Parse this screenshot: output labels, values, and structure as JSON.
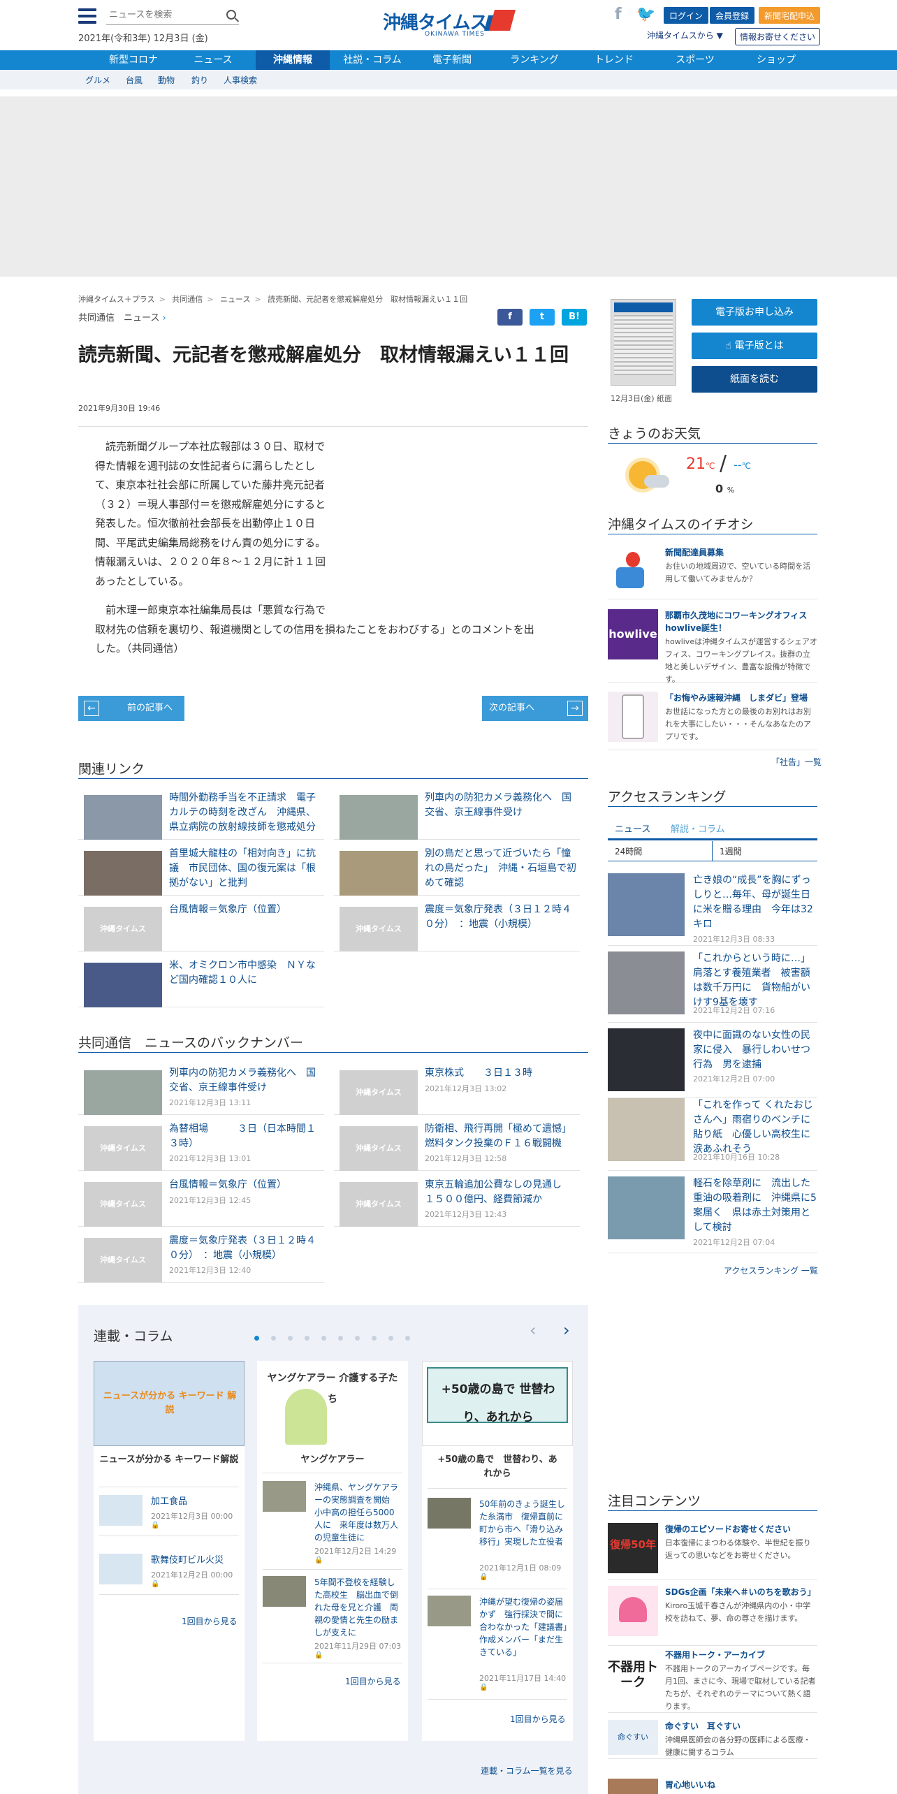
{
  "header": {
    "search_placeholder": "ニュースを検索",
    "date": "2021年(令和3年) 12月3日 (金)",
    "logo_main": "沖縄タイムス",
    "logo_sub": "OKINAWA TIMES",
    "logo_plus": "プラス",
    "login": "ログイン",
    "register": "会員登録",
    "delivery": "新聞宅配申込",
    "region": "沖縄タイムスから ▼",
    "info": "情報お寄せください",
    "colors": {
      "brand": "#0e5ba8",
      "nav": "#1386cf",
      "delivery": "#f39a2d"
    }
  },
  "nav": {
    "items": [
      "新型コロナ",
      "ニュース",
      "沖縄情報",
      "社説・コラム",
      "電子新聞",
      "ランキング",
      "トレンド",
      "スポーツ",
      "ショップ"
    ],
    "active": "沖縄情報",
    "sub": [
      "グルメ",
      "台風",
      "動物",
      "釣り",
      "人事検索"
    ]
  },
  "breadcrumb": [
    "沖縄タイムス＋プラス",
    "共同通信",
    "ニュース",
    "読売新聞、元記者を懲戒解雇処分　取材情報漏えい１１回"
  ],
  "article": {
    "category": "共同通信　ニュース",
    "share": [
      "f",
      "t",
      "B!"
    ],
    "title": "読売新聞、元記者を懲戒解雇処分　取材情報漏えい１１回",
    "date": "2021年9月30日 19:46",
    "p1": [
      "読売新聞グループ本社広報部は３０日、取材で",
      "得た情報を週刊誌の女性記者らに漏らしたとし",
      "て、東京本社社会部に所属していた藤井亮元記者",
      "（３２）＝現人事部付＝を懲戒解雇処分にすると",
      "発表した。恒次徹前社会部長を出勤停止１０日",
      "間、平尾武史編集局総務をけん責の処分にする。",
      "情報漏えいは、２０２０年８～１２月に計１１回",
      "あったとしている。"
    ],
    "p2": [
      "前木理一郎東京本社編集局長は「悪質な行為で",
      "取材先の信頼を裏切り、報道機関としての信用を損ねたことをおわびする」とのコメントを出",
      "した。（共同通信）"
    ],
    "prev": "前の記事へ",
    "next": "次の記事へ"
  },
  "related": {
    "title": "関連リンク",
    "items": [
      "時間外勤務手当を不正請求　電子カルテの時刻を改ざん　沖縄県、県立病院の放射線技師を懲戒処分",
      "列車内の防犯カメラ義務化へ　国交省、京王線事件受け",
      "首里城大龍柱の「相対向き」に抗議　市民団体、国の復元案は「根拠がない」と批判",
      "別の鳥だと思って近づいたら「憧れの鳥だった」　沖縄・石垣島で初めて確認",
      "台風情報＝気象庁（位置）",
      "震度＝気象庁発表（３日１２時４０分）　：地震（小規模）",
      "米、オミクロン市中感染　ＮＹなど国内確認１０人に"
    ],
    "placeholder": "沖縄タイムス"
  },
  "backnumber": {
    "title": "共同通信　ニュースのバックナンバー",
    "items": [
      {
        "t": "列車内の防犯カメラ義務化へ　国交省、京王線事件受け",
        "d": "2021年12月3日 13:11"
      },
      {
        "t": "東京株式　　３日１３時",
        "d": "2021年12月3日 13:02"
      },
      {
        "t": "為替相場　　　３日（日本時間１３時）",
        "d": "2021年12月3日 13:01"
      },
      {
        "t": "防衛相、飛行再開「極めて遺憾」燃料タンク投棄のＦ１６戦闘機",
        "d": "2021年12月3日 12:58"
      },
      {
        "t": "台風情報＝気象庁（位置）",
        "d": "2021年12月3日 12:45"
      },
      {
        "t": "東京五輪追加公費なしの見通し　１５００億円、経費節減か",
        "d": "2021年12月3日 12:43"
      },
      {
        "t": "震度＝気象庁発表（３日１２時４０分）　：地震（小規模）",
        "d": "2021年12月3日 12:40"
      }
    ]
  },
  "series": {
    "title": "連載・コラム",
    "cards": [
      {
        "name": "ニュースが分かる キーワード解説",
        "img_text": "ニュースが分かる キーワード 解説",
        "items": [
          {
            "t": "加工食品",
            "d": "2021年12月3日 00:00"
          },
          {
            "t": "歌舞伎町ビル火災",
            "d": "2021年12月2日 00:00"
          }
        ],
        "more": "1回目から見る"
      },
      {
        "name": "ヤングケアラー",
        "img_text": "ヤングケアラー 介護する子たち",
        "items": [
          {
            "t": "沖縄県、ヤングケアラーの実態調査を開始　小中高の担任ら5000人に　来年度は数万人の児童生徒に",
            "d": "2021年12月2日 14:29"
          },
          {
            "t": "5年間不登校を経験した高校生　脳出血で倒れた母を兄と介護　両親の愛情と先生の励ましが支えに",
            "d": "2021年11月29日 07:03"
          }
        ],
        "more": "1回目から見る"
      },
      {
        "name": "+50歳の島で　世替わり、あれから",
        "img_text": "+50歳の島で 世替わり、あれから",
        "items": [
          {
            "t": "50年前のきょう誕生した糸満市　復帰直前に町から市へ「滑り込み移行」実現した立役者",
            "d": "2021年12月1日 08:09"
          },
          {
            "t": "沖縄が望む復帰の姿届かず　強行採決で間に合わなかった「建議書」　作成メンバー「まだ生きている」",
            "d": "2021年11月17日 14:40"
          }
        ],
        "more": "1回目から見る"
      }
    ],
    "all": "連載・コラム一覧を見る"
  },
  "sidebar": {
    "paper_label": "12月3日(金) 紙面",
    "btn_apply": "電子版お申し込み",
    "btn_about": "電子版とは",
    "btn_read": "紙面を読む",
    "weather_title": "きょうのお天気",
    "weather_high": "21",
    "weather_unit": "℃",
    "weather_low": "--",
    "weather_rain": "0",
    "weather_pct": "%",
    "pick_title": "沖縄タイムスのイチオシ",
    "picks": [
      {
        "t": "新聞配達員募集",
        "d": "お住いの地域周辺で、空いている時間を活用して働いてみませんか？"
      },
      {
        "t": "那覇市久茂地にコワーキングオフィスhowlive誕生！",
        "d": "howliveは沖縄タイムスが運営するシェアオフィス、コワーキングプレイス。抜群の立地と美しいデザイン、豊富な設備が特徴です。"
      },
      {
        "t": "「お悔やみ速報沖縄　しまダビ」登場",
        "d": "お世話になった方との最後のお別れはお別れを大事にしたい・・・そんなあなたのアプリです。"
      }
    ],
    "howlive_logo": "howlive",
    "editorial": "「社告」一覧",
    "rank_title": "アクセスランキング",
    "rank_tabs": [
      "ニュース",
      "解説・コラム"
    ],
    "rank_periods": [
      "24時間",
      "1週間"
    ],
    "ranks": [
      {
        "t": "亡き娘の“成長”を胸にずっしりと…毎年、母が誕生日に米を贈る理由　今年は32キロ",
        "d": "2021年12月3日 08:33"
      },
      {
        "t": "「これからという時に…」肩落とす養殖業者　被害額は数千万円に　貨物船がいけす9基を壊す",
        "d": "2021年12月2日 07:16"
      },
      {
        "t": "夜中に面識のない女性の民家に侵入　暴行しわいせつ行為　男を逮捕",
        "d": "2021年12月2日 07:00"
      },
      {
        "t": "「これを作って くれたおじさんへ」雨宿りのベンチに貼り紙　心優しい高校生に涙あふれそう",
        "d": "2021年10月16日 10:28"
      },
      {
        "t": "軽石を除草剤に　流出した重油の吸着剤に　沖縄県に5案届く　県は赤土対策用として検討",
        "d": "2021年12月2日 07:04"
      }
    ],
    "rank_all": "アクセスランキング 一覧",
    "attn_title": "注目コンテンツ",
    "attn": [
      {
        "t": "復帰のエピソードお寄せください",
        "d": "日本復帰にまつわる体験や、半世紀を振り返っての思いなどをお寄せください。",
        "img": "復帰50年"
      },
      {
        "t": "SDGs企画「未来へ＃いのちを歌おう」",
        "d": "Kiroro玉城千春さんが沖縄県内の小・中学校を訪ねて、夢、命の尊さを描けます。",
        "img": ""
      },
      {
        "t": "不器用トーク・アーカイブ",
        "d": "不器用トークのアーカイブページです。毎月1回、まさに今、現場で取材している記者たちが、それぞれのテーマについて熱く語ります。",
        "img": "不器用トーク"
      },
      {
        "t": "命ぐすい　耳ぐすい",
        "d": "沖縄県医師会の各分野の医師による医療・健康に関するコラム",
        "img": "命ぐすい"
      },
      {
        "t": "胃心地いいね",
        "d": "",
        "img": ""
      }
    ]
  }
}
